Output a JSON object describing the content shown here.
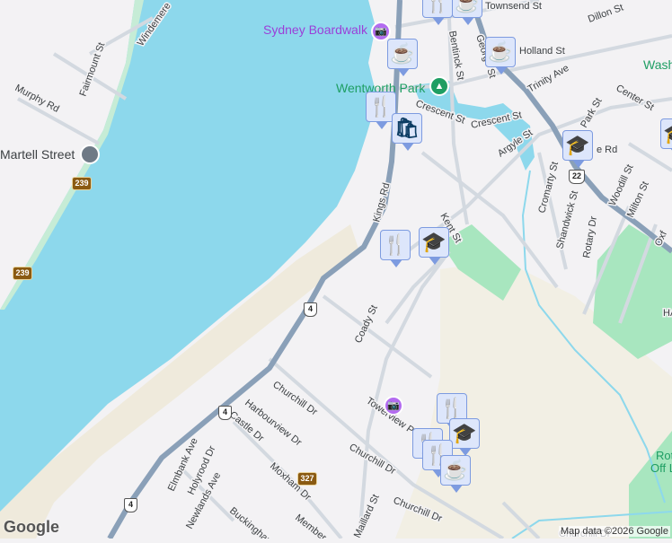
{
  "colors": {
    "water": "#8dd8ec",
    "land": "#f3f2f4",
    "park": "#a8e6bf",
    "beige": "#f2efe4",
    "highway": "#8aa0b8",
    "road": "#d3d9e0",
    "poi_bg": "#dde6fb",
    "poi_icon": "#0c3c63",
    "camera_pin": "#b36bf0",
    "park_pin": "#1e9e63"
  },
  "places": {
    "boardwalk": "Sydney Boardwalk",
    "wentworth": "Wentworth Park",
    "martell": "Martell Street",
    "washington": "Wash",
    "rotary": "Rota",
    "rotary2": "Off Le"
  },
  "streets": {
    "townsend": "Townsend St",
    "dillon": "Dillon St",
    "george": "George St",
    "bentinck": "Bentinck St",
    "holland": "Holland St",
    "trinity": "Trinity Ave",
    "center": "Center St",
    "crescent1": "Crescent St",
    "crescent2": "Crescent St",
    "argyle": "Argyle St",
    "park": "Park St",
    "kings": "Kings Rd",
    "kent": "Kent St",
    "cromarty": "Cromarty St",
    "shandwick": "Shandwick St",
    "rotary_dr": "Rotary Dr",
    "woodill": "Woodill St",
    "milton": "Milton St",
    "oxford": "Oxf",
    "byng": "e Rd",
    "windemere": "Windemere",
    "fairmount": "Fairmount St",
    "murphy": "Murphy Rd",
    "coady": "Coady St",
    "churchill1": "Churchill Dr",
    "churchill2": "Churchill Dr",
    "churchill3": "Churchill Dr",
    "churchill4": "Churchill Dr",
    "harbourview": "Harbourview Dr",
    "castle": "Castle Dr",
    "towerview": "Towerview P",
    "moxham": "Moxham Dr",
    "elmbank": "Elmbank Ave",
    "holyrood": "Holyrood Dr",
    "newlands": "Newlands Ave",
    "buckingham": "Buckingham",
    "members": "Member",
    "maillard": "Maillard St",
    "ha": "HA"
  },
  "shields": {
    "r239a": "239",
    "r239b": "239",
    "r4a": "4",
    "r4b": "4",
    "r4c": "4",
    "r22": "22",
    "r327": "327"
  },
  "icons": {
    "coffee": "☕",
    "food": "🍴",
    "shop": "🛍",
    "school": "🎓",
    "camera": "📷",
    "tree": "▲"
  },
  "footer": {
    "logo": "Google",
    "attribution": "Map data ©2026 Google"
  }
}
